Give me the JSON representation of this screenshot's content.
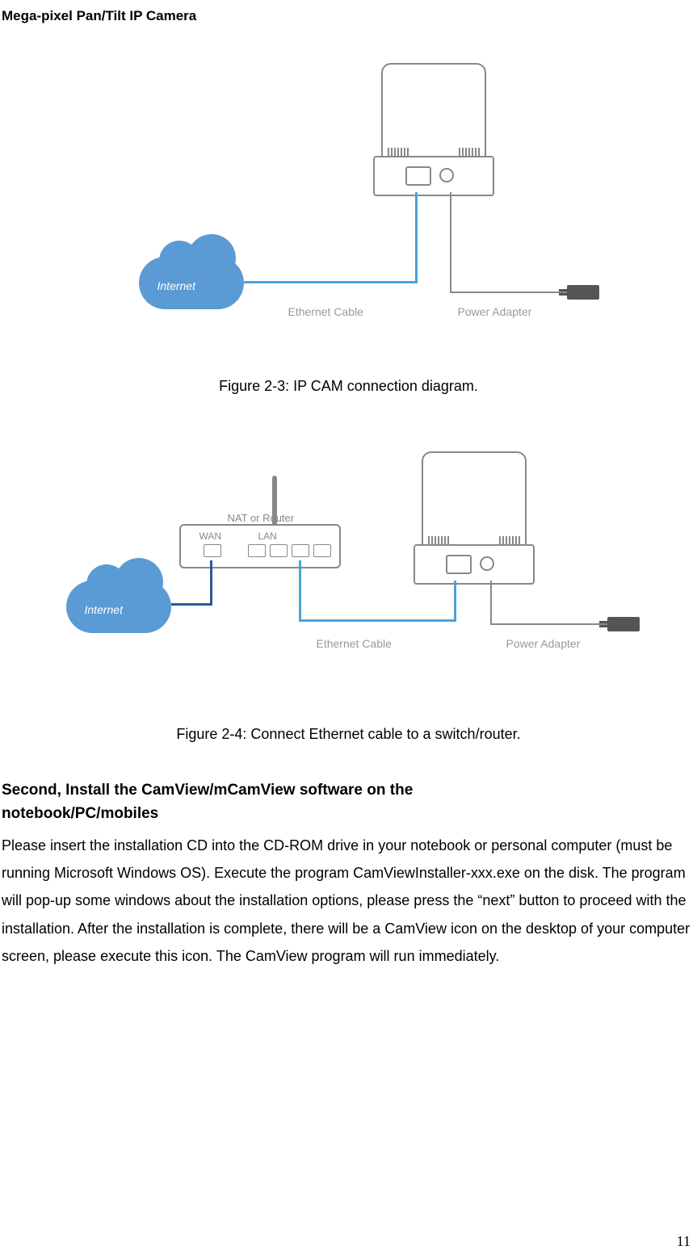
{
  "header": "Mega-pixel Pan/Tilt IP Camera",
  "figure1": {
    "cloud_label": "Internet",
    "ethernet_label": "Ethernet Cable",
    "power_label": "Power Adapter",
    "caption": "Figure 2-3: IP CAM connection diagram."
  },
  "figure2": {
    "cloud_label": "Internet",
    "nat_label": "NAT or Router",
    "wan_label": "WAN",
    "lan_label": "LAN",
    "ethernet_label": "Ethernet Cable",
    "power_label": "Ethernet Cable                                    Power Adapter",
    "eth_lbl": "Ethernet Cable",
    "pwr_lbl": "Power Adapter",
    "caption": "Figure 2-4: Connect Ethernet cable to a switch/router."
  },
  "section": {
    "heading_line1": "Second, Install the CamView/mCamView software on the",
    "heading_line2": "notebook/PC/mobiles",
    "body": "Please insert the installation CD into the CD-ROM drive in your notebook or personal computer (must be running Microsoft Windows OS). Execute the program CamViewInstaller-xxx.exe on the disk. The program will pop-up some windows about the installation options, please press the “next” button to proceed with the installation. After the installation is complete, there will be a CamView icon on the desktop of your computer screen, please execute this icon. The CamView program will run immediately."
  },
  "page_number": "11"
}
